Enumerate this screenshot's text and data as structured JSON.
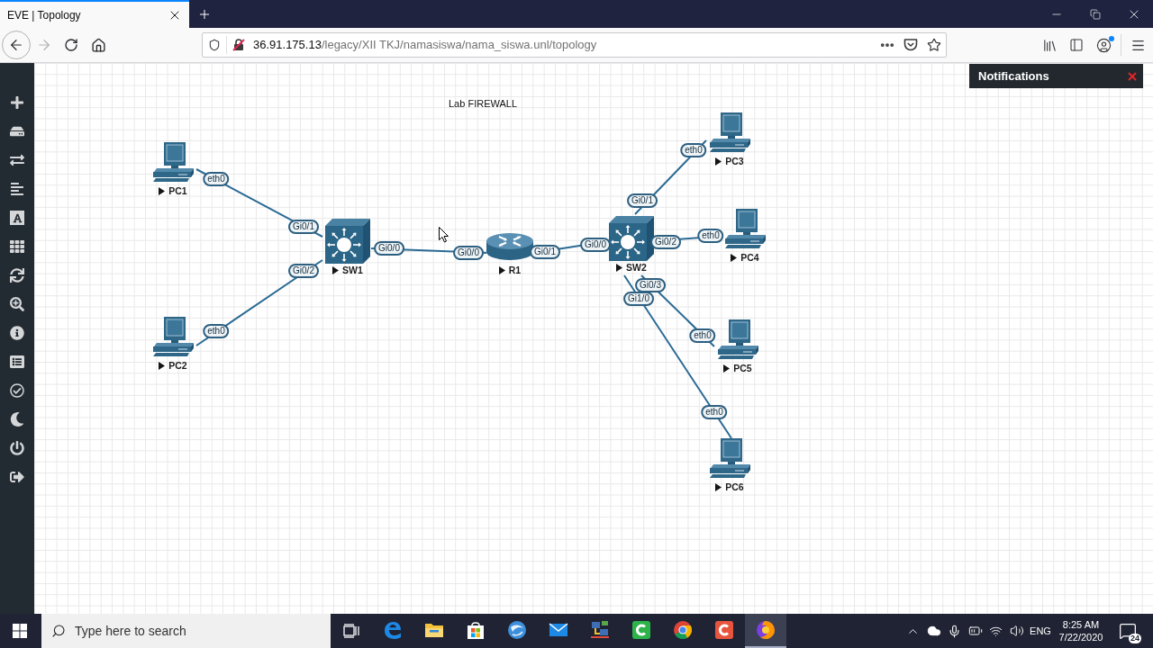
{
  "browser": {
    "tab": {
      "title": "EVE | Topology",
      "selected": true
    },
    "address": {
      "host": "36.91.175.13",
      "path": "/legacy/XII TKJ/namasiswa/nama_siswa.unl/topology"
    }
  },
  "notifications": {
    "title": "Notifications"
  },
  "topology": {
    "title": "Lab FIREWALL",
    "nodes": [
      {
        "name": "PC1",
        "kind": "pc"
      },
      {
        "name": "PC2",
        "kind": "pc"
      },
      {
        "name": "SW1",
        "kind": "switch"
      },
      {
        "name": "R1",
        "kind": "router"
      },
      {
        "name": "SW2",
        "kind": "switch"
      },
      {
        "name": "PC3",
        "kind": "pc"
      },
      {
        "name": "PC4",
        "kind": "pc"
      },
      {
        "name": "PC5",
        "kind": "pc"
      },
      {
        "name": "PC6",
        "kind": "pc"
      }
    ],
    "links": [
      {
        "ports": [
          "eth0",
          "Gi0/1"
        ]
      },
      {
        "ports": [
          "eth0",
          "Gi0/2"
        ]
      },
      {
        "ports": [
          "Gi0/0",
          "Gi0/0"
        ]
      },
      {
        "ports": [
          "Gi0/1",
          "Gi0/0"
        ]
      },
      {
        "ports": [
          "Gi0/1",
          "eth0"
        ]
      },
      {
        "ports": [
          "Gi0/2",
          "eth0"
        ]
      },
      {
        "ports": [
          "Gi0/3",
          "eth0"
        ]
      },
      {
        "ports": [
          "Gi1/0",
          "eth0"
        ]
      }
    ]
  },
  "taskbar": {
    "search": {
      "placeholder": "Type here to search"
    },
    "apps": [
      {
        "active": false
      },
      {
        "active": false
      },
      {
        "active": false
      },
      {
        "active": false
      },
      {
        "active": false
      },
      {
        "active": false
      },
      {
        "active": false
      },
      {
        "active": false
      },
      {
        "active": false
      },
      {
        "active": true
      }
    ],
    "tray": {
      "language": "ENG",
      "time": "8:25 AM",
      "date": "7/22/2020",
      "notification_count": "24"
    }
  }
}
